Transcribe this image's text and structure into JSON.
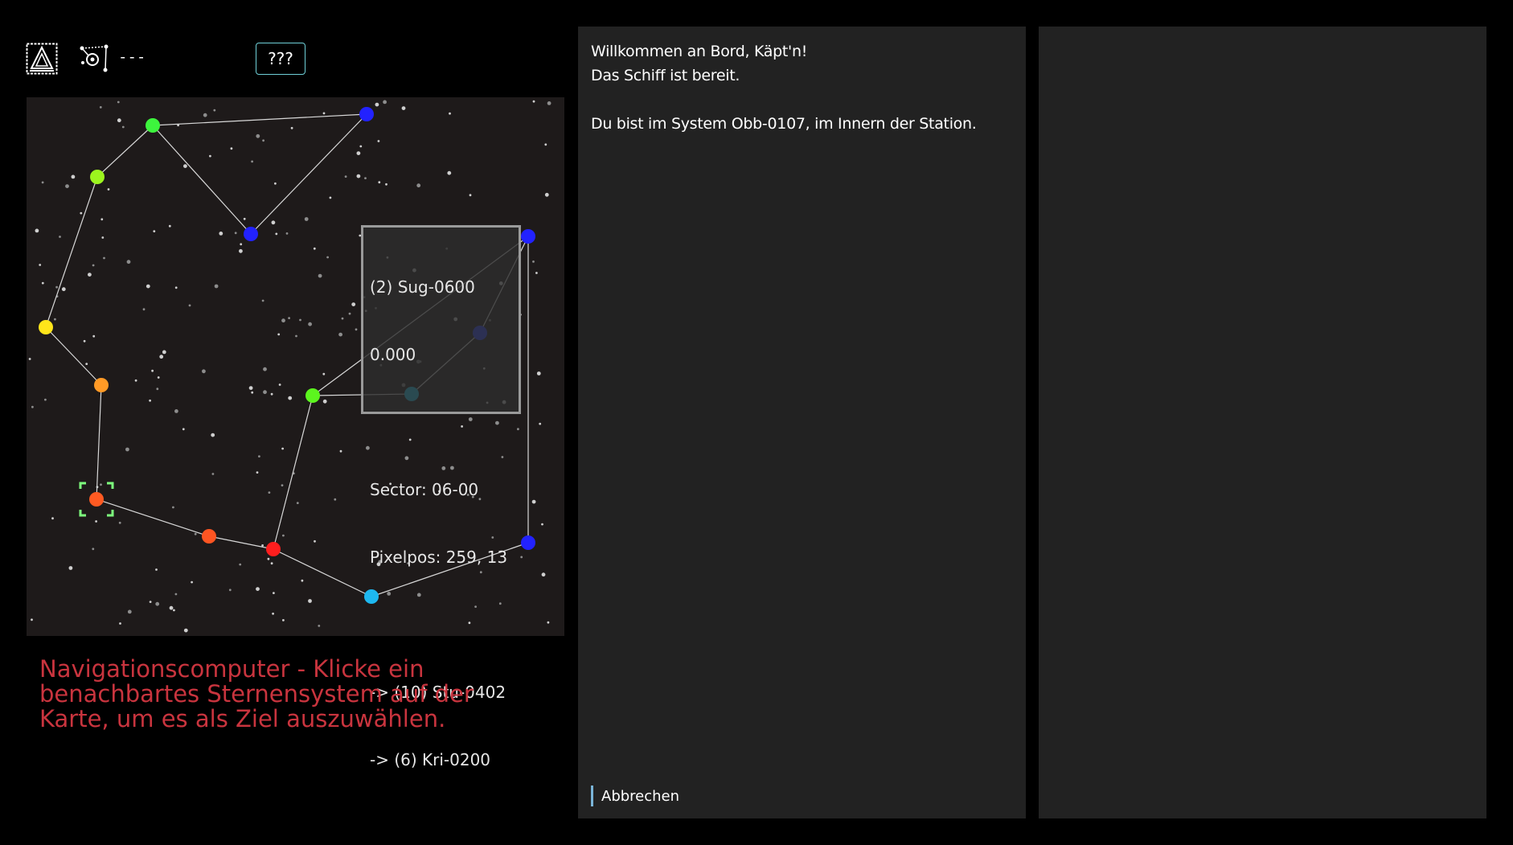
{
  "toolbar": {
    "ship_icon": "ship-emblem-icon",
    "nav_icon": "navigation-network-icon",
    "target_label": "---",
    "unknown_button_label": "???"
  },
  "star_map": {
    "background": "#1e1a1a",
    "systems": [
      {
        "id": "s1",
        "color": "#3df53d"
      },
      {
        "id": "s2",
        "color": "#2222ff"
      },
      {
        "id": "s3",
        "color": "#9cf51e"
      },
      {
        "id": "s4",
        "color": "#2222ff"
      },
      {
        "id": "s5",
        "color": "#2222ff"
      },
      {
        "id": "s6",
        "color": "#ffe51a"
      },
      {
        "id": "s7",
        "color": "#ff9a26"
      },
      {
        "id": "s8",
        "color": "#2a3dff"
      },
      {
        "id": "s9",
        "color": "#5cf51e"
      },
      {
        "id": "s10",
        "color": "#1ecbf0"
      },
      {
        "id": "s11",
        "color": "#ff5a22"
      },
      {
        "id": "s12",
        "color": "#ff5522"
      },
      {
        "id": "s13",
        "color": "#ff1e1e"
      },
      {
        "id": "s14",
        "color": "#1eb8f0"
      },
      {
        "id": "s15",
        "color": "#2222ff"
      }
    ],
    "selection_color": "#7dff7d",
    "tooltip": {
      "lines": [
        "(2) Sug-0600",
        "0.000",
        "",
        "Sector: 06-00",
        "Pixelpos: 259, 13",
        "",
        "-> (10) Stu-0402",
        "-> (6) Kri-0200"
      ]
    }
  },
  "nav_hint": "Navigationscomputer - Klicke ein benachbartes Sternensystem auf der Karte, um es als Ziel auszuwählen.",
  "console": {
    "lines": [
      "Willkommen an Bord, Käpt'n!",
      "Das Schiff ist bereit.",
      "",
      "Du bist im System Obb-0107, im Innern der Station."
    ],
    "cancel_label": "Abbrechen"
  },
  "colors": {
    "hint": "#c9343e",
    "panel": "#222222",
    "button_border": "#6fd0d8",
    "cancel_bar": "#7ab4d8"
  }
}
